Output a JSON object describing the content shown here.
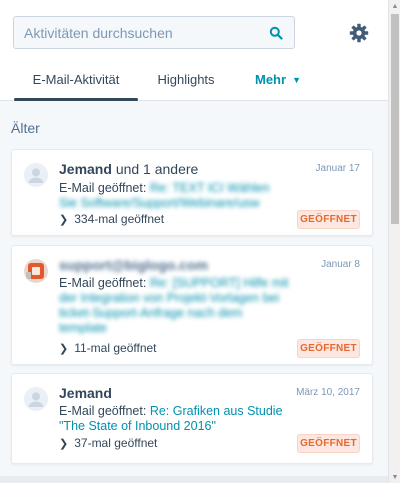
{
  "search": {
    "placeholder": "Aktivitäten durchsuchen"
  },
  "tabs": [
    {
      "label": "E-Mail-Aktivität",
      "active": true
    },
    {
      "label": "Highlights",
      "active": false
    },
    {
      "label": "Mehr",
      "active": false
    }
  ],
  "section_title": "Älter",
  "colors": {
    "link": "#0091ae",
    "badge_text": "#e8672c",
    "badge_bg": "#fde8e1",
    "text": "#33475b"
  },
  "cards": [
    {
      "who_name": "Jemand",
      "who_rest": "und 1 andere",
      "date": "Januar 17",
      "opened_prefix": "E-Mail geöffnet:",
      "subject": "Re: TEXT ICI Wählen Sie Software/Support/Webinare/usw",
      "opens": "334-mal geöffnet",
      "badge": "GEÖFFNET",
      "avatar": "person-avatar"
    },
    {
      "who_name": "support@biglogo.com",
      "who_rest": "",
      "date": "Januar 8",
      "opened_prefix": "E-Mail geöffnet:",
      "subject": "Re: [SUPPORT] Hilfe mit der Integration von Projekt-Vorlagen bei ticket-Support-Anfrage nach dem template",
      "opens": "11-mal geöffnet",
      "badge": "GEÖFFNET",
      "avatar": "company-logo-avatar"
    },
    {
      "who_name": "Jemand",
      "who_rest": "",
      "date": "März 10, 2017",
      "opened_prefix": "E-Mail geöffnet:",
      "subject": "Re: Grafiken aus Studie \"The State of Inbound 2016\"",
      "opens": "37-mal geöffnet",
      "badge": "GEÖFFNET",
      "avatar": "person-avatar"
    }
  ]
}
